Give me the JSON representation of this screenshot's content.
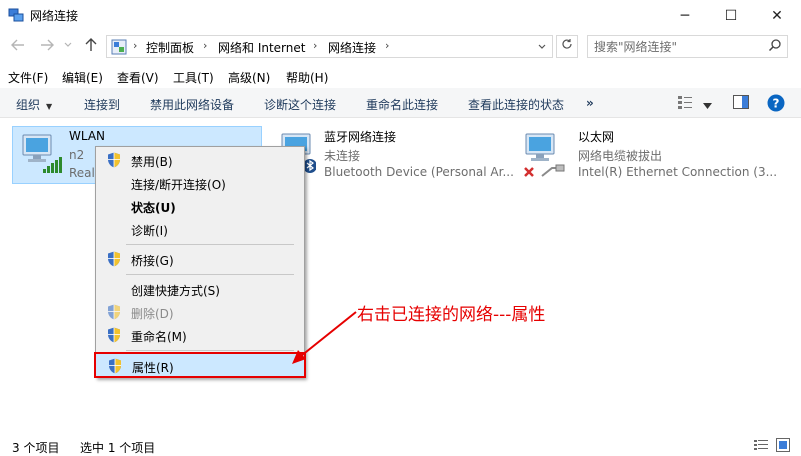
{
  "window": {
    "title": "网络连接",
    "minimize_glyph": "─",
    "maximize_glyph": "☐",
    "close_glyph": "✕"
  },
  "address_bar": {
    "crumbs": [
      "控制面板",
      "网络和 Internet",
      "网络连接"
    ],
    "separator": "›",
    "search_placeholder": "搜索\"网络连接\""
  },
  "menubar": {
    "items": [
      "文件(F)",
      "编辑(E)",
      "查看(V)",
      "工具(T)",
      "高级(N)",
      "帮助(H)"
    ]
  },
  "commandbar": {
    "organize": "组织",
    "items": [
      "连接到",
      "禁用此网络设备",
      "诊断这个连接",
      "重命名此连接",
      "查看此连接的状态"
    ],
    "more": "»"
  },
  "connections": [
    {
      "name": "WLAN",
      "line1": "n2",
      "line2": "Realtek",
      "status_color": "#2d8a2d"
    },
    {
      "name": "蓝牙网络连接",
      "line1": "未连接",
      "line2": "Bluetooth Device (Personal Ar..."
    },
    {
      "name": "以太网",
      "line1": "网络电缆被拔出",
      "line2": "Intel(R) Ethernet Connection (3..."
    }
  ],
  "context_menu": {
    "items": [
      {
        "label": "禁用(B)",
        "shield": true
      },
      {
        "label": "连接/断开连接(O)",
        "shield": false
      },
      {
        "label": "状态(U)",
        "shield": false,
        "bold": true
      },
      {
        "label": "诊断(I)",
        "shield": false
      },
      {
        "label": "桥接(G)",
        "shield": true
      },
      {
        "label": "创建快捷方式(S)",
        "shield": false
      },
      {
        "label": "删除(D)",
        "shield": true,
        "disabled": true
      },
      {
        "label": "重命名(M)",
        "shield": true
      },
      {
        "label": "属性(R)",
        "shield": true,
        "highlighted": true
      }
    ]
  },
  "annotation": {
    "text": "右击已连接的网络---属性",
    "color": "#e60000"
  },
  "statusbar": {
    "count": "3 个项目",
    "selected": "选中 1 个项目"
  },
  "colors": {
    "accent": "#0078d7",
    "selection": "#cce8ff",
    "annotation_red": "#e60000"
  }
}
